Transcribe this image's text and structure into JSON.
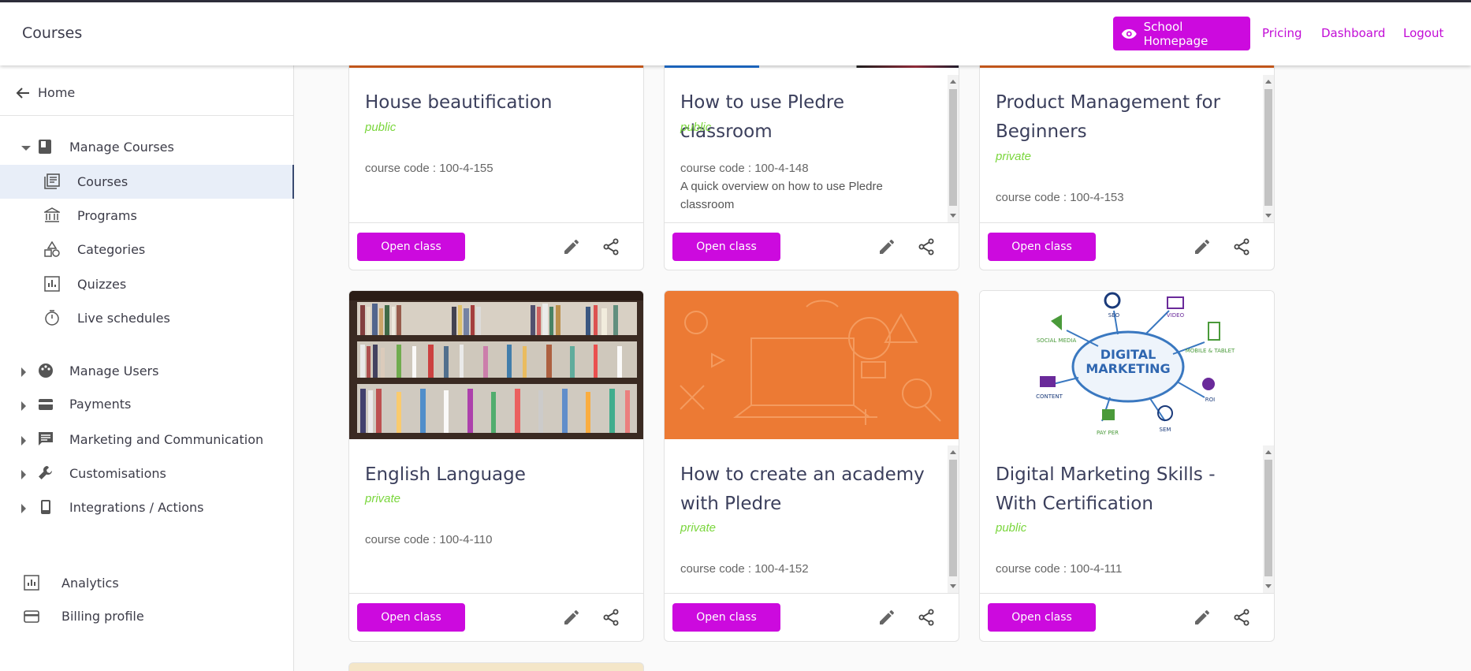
{
  "app": {
    "title": "Courses",
    "accent": "#cc0ade"
  },
  "topnav": {
    "school_homepage": "School Homepage",
    "pricing": "Pricing",
    "dashboard": "Dashboard",
    "logout": "Logout"
  },
  "sidebar": {
    "home": "Home",
    "manage_courses": "Manage Courses",
    "courses_sub": [
      "Courses",
      "Programs",
      "Categories",
      "Quizzes",
      "Live schedules"
    ],
    "groups": [
      "Manage Users",
      "Payments",
      "Marketing and Communication",
      "Customisations",
      "Integrations / Actions"
    ],
    "bottom": [
      "Analytics",
      "Billing profile"
    ]
  },
  "cards": [
    {
      "title": "House beautification",
      "visibility": "public",
      "code": "course code : 100-4-155",
      "description": "",
      "open": "Open class",
      "image": "orange-banner"
    },
    {
      "title": "How to use Pledre classroom",
      "visibility": "public",
      "code": "course code : 100-4-148",
      "description": "A quick overview on how to use Pledre classroom",
      "open": "Open class",
      "image": "multicolor-banner"
    },
    {
      "title": "Product Management for Beginners",
      "visibility": "private",
      "code": "course code : 100-4-153",
      "description": "",
      "open": "Open class",
      "image": "orange-banner"
    },
    {
      "title": "English Language",
      "visibility": "private",
      "code": "course code : 100-4-110",
      "description": "",
      "open": "Open class",
      "image": "bookshelf-photo"
    },
    {
      "title": "How to create an academy with Pledre",
      "visibility": "private",
      "code": "course code : 100-4-152",
      "description": "",
      "open": "Open class",
      "image": "orange-laptop-pattern"
    },
    {
      "title": "Digital Marketing Skills - With Certification",
      "visibility": "public",
      "code": "course code : 100-4-111",
      "description": "",
      "open": "Open class",
      "image": "digital-marketing-diagram"
    }
  ],
  "digital_marketing_image": {
    "center": [
      "DIGITAL",
      "MARKETING"
    ],
    "labels": [
      "SEO",
      "VIDEO",
      "SOCIAL MEDIA",
      "MOBILE & TABLET",
      "CONTENT",
      "ROI",
      "PAY PER",
      "SEM"
    ]
  }
}
